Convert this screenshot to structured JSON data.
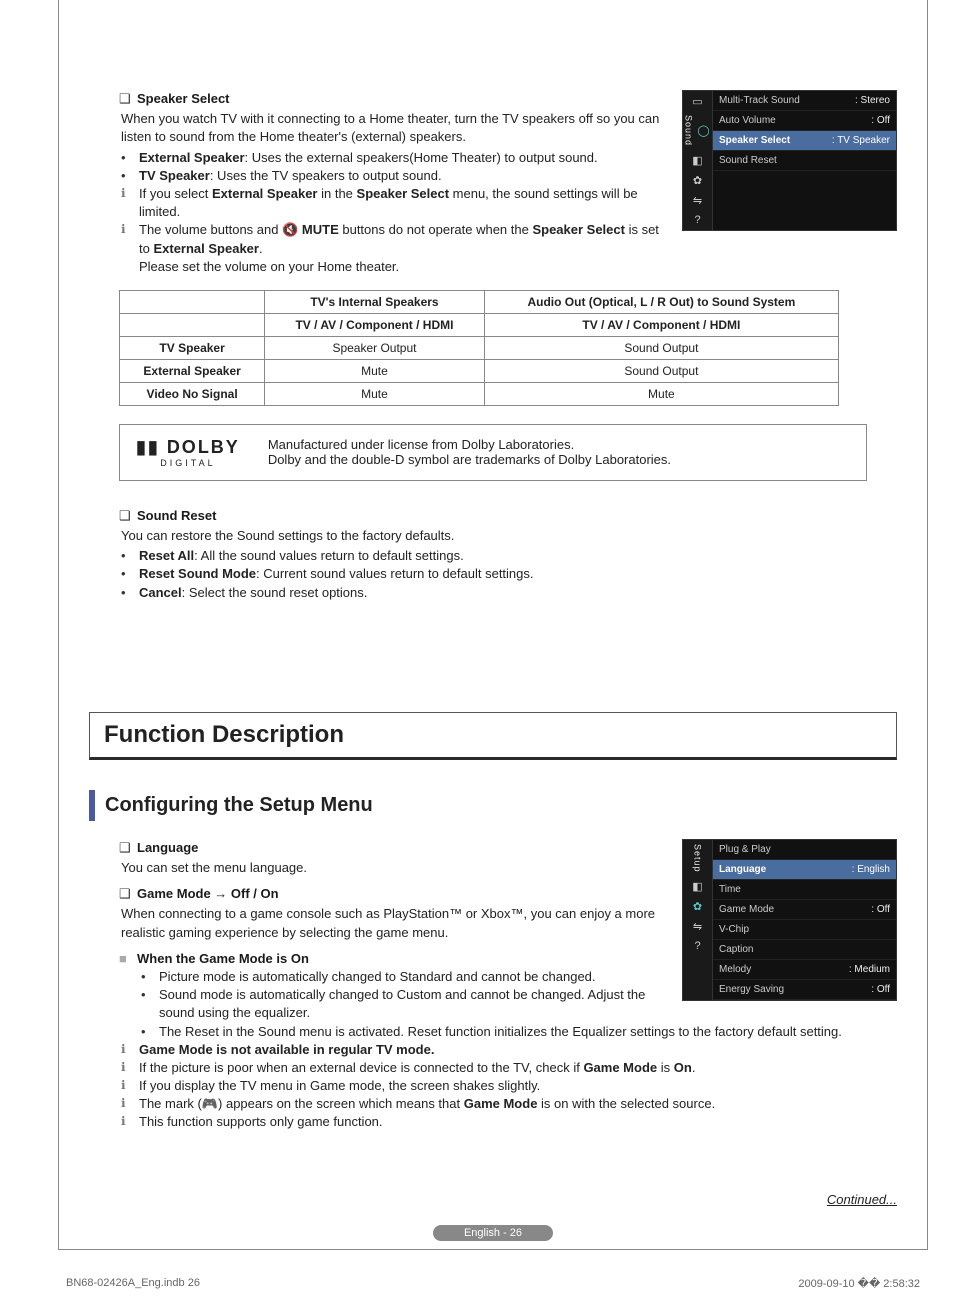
{
  "speakerSelect": {
    "title": "Speaker Select",
    "desc": "When you watch TV with it connecting to a Home theater, turn the TV speakers off so you can listen to sound from the Home theater's (external) speakers.",
    "bullets": [
      {
        "term": "External Speaker",
        "after": ": Uses the external speakers(Home Theater) to output sound."
      },
      {
        "term": "TV Speaker",
        "after": ": Uses the TV speakers to output sound."
      }
    ],
    "notes": [
      {
        "pre": "If you select ",
        "b1": "External Speaker",
        "mid1": " in the ",
        "b2": "Speaker Select",
        "mid2": " menu, the sound settings will be limited."
      },
      {
        "pre": "The volume buttons and ",
        "muteIcon": "🔇",
        "b1": "MUTE",
        "mid1": " buttons do not operate when the ",
        "b2": "Speaker Select",
        "mid2": " is set to ",
        "b3": "External Speaker",
        "after": ".",
        "tail": "Please set the volume on your Home theater."
      }
    ]
  },
  "osdSound": {
    "vlabel": "Sound",
    "rows": [
      {
        "label": "Multi-Track Sound",
        "value": ": Stereo"
      },
      {
        "label": "Auto Volume",
        "value": ": Off"
      },
      {
        "label": "Speaker Select",
        "value": ": TV Speaker",
        "selected": true
      },
      {
        "label": "Sound Reset",
        "value": ""
      }
    ]
  },
  "table": {
    "head1": {
      "c1": "",
      "c2": "TV's Internal Speakers",
      "c3": "Audio Out (Optical, L / R Out) to Sound System"
    },
    "head2": {
      "c2": "TV / AV / Component / HDMI",
      "c3": "TV / AV / Component / HDMI"
    },
    "rows": [
      {
        "c1": "TV Speaker",
        "c2": "Speaker Output",
        "c3": "Sound Output"
      },
      {
        "c1": "External Speaker",
        "c2": "Mute",
        "c3": "Sound Output"
      },
      {
        "c1": "Video No Signal",
        "c2": "Mute",
        "c3": "Mute"
      }
    ]
  },
  "dolby": {
    "brand": "DOLBY",
    "sub": "DIGITAL",
    "line1": "Manufactured under license from Dolby Laboratories.",
    "line2": "Dolby and the double-D symbol are trademarks of Dolby Laboratories."
  },
  "soundReset": {
    "title": "Sound Reset",
    "desc": "You can restore the Sound settings to the factory defaults.",
    "bullets": [
      {
        "term": "Reset All",
        "after": ": All the sound values return to default settings."
      },
      {
        "term": "Reset Sound Mode",
        "after": ": Current sound values return to default settings."
      },
      {
        "term": "Cancel",
        "after": ": Select the sound reset options."
      }
    ]
  },
  "funcHeader": "Function Description",
  "setupHeader": "Configuring the Setup Menu",
  "language": {
    "title": "Language",
    "desc": "You can set the menu language."
  },
  "gameMode": {
    "title": "Game Mode → Off / On",
    "desc": "When connecting to a game console such as PlayStation™ or Xbox™, you can enjoy a more realistic gaming experience by selecting the game menu."
  },
  "gameOn": {
    "title": "When the Game Mode is On",
    "bullets": [
      "Picture mode is automatically changed to Standard and cannot be changed.",
      "Sound mode is automatically changed to Custom and cannot be changed. Adjust the sound using the equalizer.",
      "The Reset in the Sound menu is activated. Reset function initializes the Equalizer settings to the factory default setting."
    ],
    "notes": [
      {
        "bold": "Game Mode is not available in regular TV mode."
      },
      {
        "pre": "If the picture is poor when an external device is connected to the TV, check if ",
        "b1": "Game Mode",
        "mid1": " is ",
        "b2": "On",
        "after": "."
      },
      {
        "pre": "If you display the TV menu in Game mode, the screen shakes slightly."
      },
      {
        "pre": "The mark (",
        "icon": "🎮",
        "mid1": ") appears on the screen which means that ",
        "b1": "Game Mode",
        "after": " is on with the selected source."
      },
      {
        "pre": "This function supports only game function."
      }
    ]
  },
  "osdSetup": {
    "vlabel": "Setup",
    "rows": [
      {
        "label": "Plug & Play",
        "value": ""
      },
      {
        "label": "Language",
        "value": ": English",
        "selected": true
      },
      {
        "label": "Time",
        "value": ""
      },
      {
        "label": "Game Mode",
        "value": ": Off"
      },
      {
        "label": "V-Chip",
        "value": ""
      },
      {
        "label": "Caption",
        "value": ""
      },
      {
        "label": "Melody",
        "value": ": Medium"
      },
      {
        "label": "Energy Saving",
        "value": ": Off"
      }
    ]
  },
  "continued": "Continued...",
  "pageBadge": "English - 26",
  "footer": {
    "left": "BN68-02426A_Eng.indb   26",
    "right": "2009-09-10   �� 2:58:32"
  }
}
